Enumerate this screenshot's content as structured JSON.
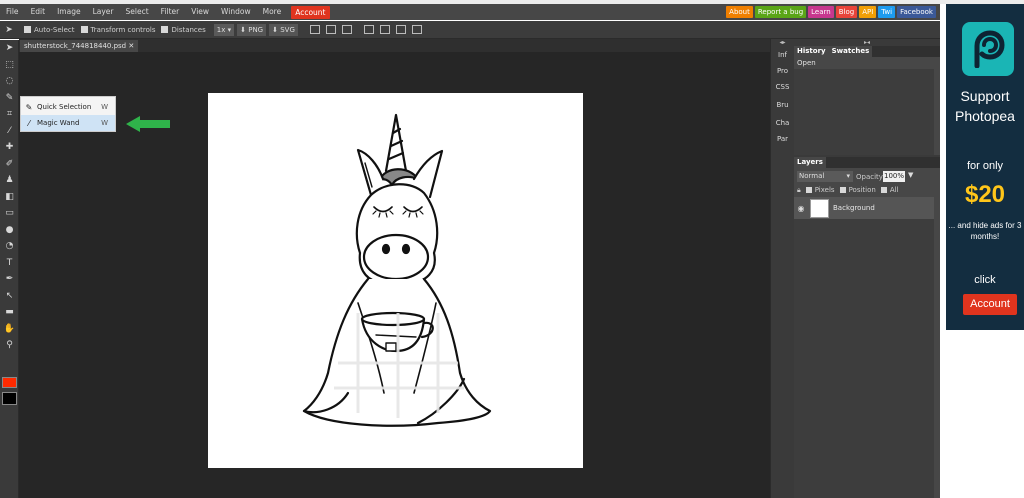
{
  "menu": {
    "items": [
      "File",
      "Edit",
      "Image",
      "Layer",
      "Select",
      "Filter",
      "View",
      "Window",
      "More"
    ],
    "account": "Account"
  },
  "top_links": [
    {
      "label": "About",
      "color": "#f07f00"
    },
    {
      "label": "Report a bug",
      "color": "#5aa517"
    },
    {
      "label": "Learn",
      "color": "#c7378e"
    },
    {
      "label": "Blog",
      "color": "#e8443a"
    },
    {
      "label": "API",
      "color": "#f29f05"
    },
    {
      "label": "Twi",
      "color": "#1d9bf0"
    },
    {
      "label": "Facebook",
      "color": "#3b5998"
    }
  ],
  "options": {
    "auto_select": "Auto-Select",
    "transform_controls": "Transform controls",
    "distances": "Distances",
    "zoom": "1x",
    "png": "PNG",
    "svg": "SVG"
  },
  "document": {
    "tab": "shutterstock_744818440.psd"
  },
  "popup": {
    "items": [
      {
        "label": "Quick Selection",
        "key": "W"
      },
      {
        "label": "Magic Wand",
        "key": "W"
      }
    ]
  },
  "mini_panel": {
    "header": "◂▸",
    "tabs": [
      "Inf",
      "Pro",
      "CSS",
      "Bru",
      "Cha",
      "Par"
    ]
  },
  "history_panel": {
    "header": "▸◂",
    "tabs": [
      "History",
      "Swatches"
    ],
    "items": [
      "Open"
    ]
  },
  "layers_panel": {
    "tab": "Layers",
    "blend_mode": "Normal",
    "opacity_label": "Opacity:",
    "opacity": "100%",
    "lock_pixels": "Pixels",
    "lock_position": "Position",
    "lock_all": "All",
    "layer_name": "Background"
  },
  "ad": {
    "line1": "Support",
    "line2": "Photopea",
    "for_only": "for only",
    "price": "$20",
    "hide_ads": "... and hide ads for 3 months!",
    "click": "click",
    "account": "Account"
  },
  "colors": {
    "foreground": "#ff2a00",
    "background": "#000000",
    "accent": "#e0341e"
  }
}
